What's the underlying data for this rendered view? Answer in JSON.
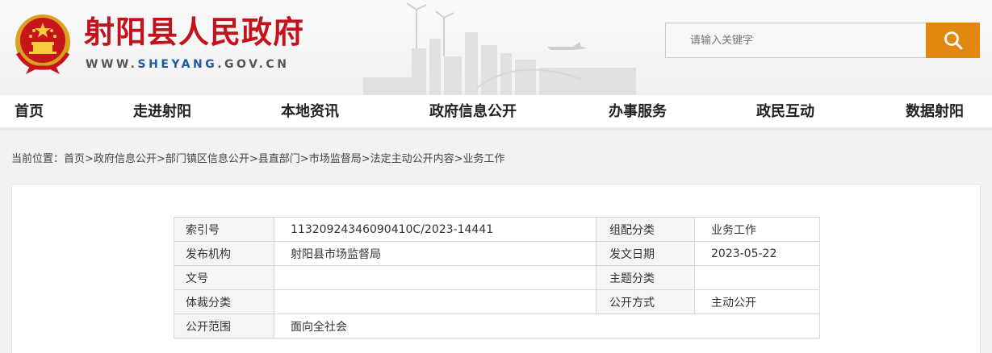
{
  "header": {
    "site_title": "射阳县人民政府",
    "url_prefix": "WWW.",
    "url_mid": "SHEYANG",
    "url_suffix": ".GOV.CN",
    "search_placeholder": "请输入关键字",
    "colors": {
      "title": "#c4111b",
      "search_button": "#e3870f",
      "url_accent": "#1f5c99"
    }
  },
  "nav": {
    "items": [
      "首页",
      "走进射阳",
      "本地资讯",
      "政府信息公开",
      "办事服务",
      "政民互动",
      "数据射阳"
    ]
  },
  "breadcrumb": {
    "prefix": "当前位置：",
    "items": [
      "首页",
      "政府信息公开",
      "部门镇区信息公开",
      "县直部门",
      "市场监督局",
      "法定主动公开内容",
      "业务工作"
    ],
    "separator": ">"
  },
  "meta": {
    "rows": [
      {
        "label1": "索引号",
        "value1": "11320924346090410C/2023-14441",
        "label2": "组配分类",
        "value2": "业务工作"
      },
      {
        "label1": "发布机构",
        "value1": "射阳县市场监督局",
        "label2": "发文日期",
        "value2": "2023-05-22"
      },
      {
        "label1": "文号",
        "value1": "",
        "label2": "主题分类",
        "value2": ""
      },
      {
        "label1": "体裁分类",
        "value1": "",
        "label2": "公开方式",
        "value2": "主动公开"
      },
      {
        "label1": "公开范围",
        "value1": "面向全社会"
      }
    ]
  }
}
